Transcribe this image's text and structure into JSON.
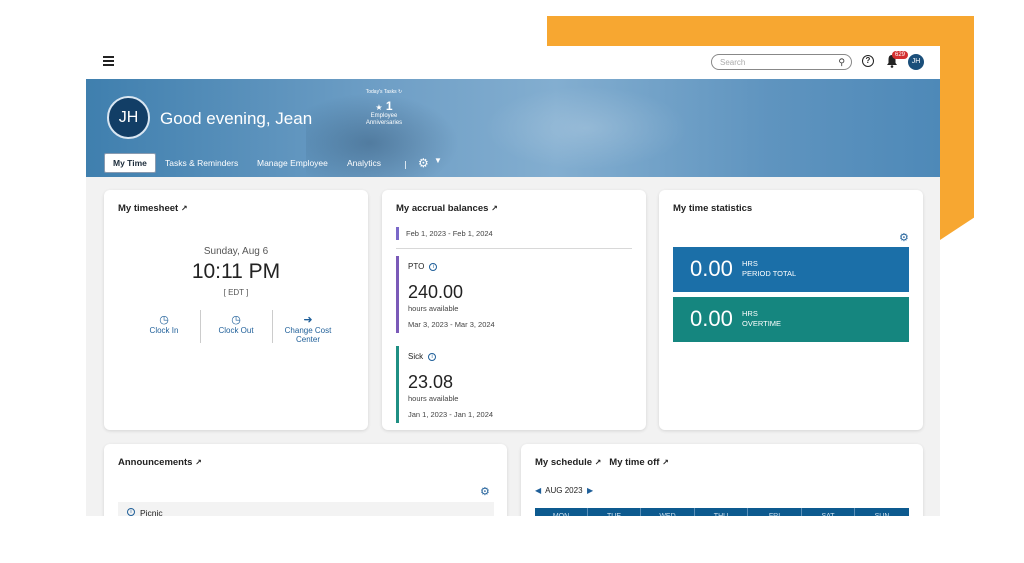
{
  "header": {
    "search_placeholder": "Search",
    "notification_count": "629",
    "user_initials": "JH"
  },
  "banner": {
    "avatar_initials": "JH",
    "greeting": "Good evening, Jean",
    "todays_tasks": {
      "title": "Today's Tasks",
      "count": "1",
      "label_line1": "Employee",
      "label_line2": "Anniversaries"
    },
    "tabs": [
      "My Time",
      "Tasks & Reminders",
      "Manage Employee",
      "Analytics"
    ]
  },
  "timesheet": {
    "title": "My timesheet",
    "date": "Sunday, Aug 6",
    "time": "10:11 PM",
    "timezone": "[ EDT ]",
    "actions": [
      {
        "label_line1": "Clock In",
        "label_line2": ""
      },
      {
        "label_line1": "Clock Out",
        "label_line2": ""
      },
      {
        "label_line1": "Change Cost",
        "label_line2": "Center"
      }
    ]
  },
  "accruals": {
    "title": "My accrual balances",
    "period": "Feb 1, 2023 - Feb 1, 2024",
    "items": [
      {
        "name": "PTO",
        "value": "240.00",
        "unit": "hours available",
        "range": "Mar 3, 2023 - Mar 3, 2024",
        "color": "#7a5ab8"
      },
      {
        "name": "Sick",
        "value": "23.08",
        "unit": "hours available",
        "range": "Jan 1, 2023 - Jan 1, 2024",
        "color": "#1f8f83"
      }
    ]
  },
  "statistics": {
    "title": "My time statistics",
    "items": [
      {
        "value": "0.00",
        "unit": "HRS",
        "label": "PERIOD TOTAL",
        "color": "#1b6fa8"
      },
      {
        "value": "0.00",
        "unit": "HRS",
        "label": "OVERTIME",
        "color": "#15867f"
      }
    ]
  },
  "announcements": {
    "title": "Announcements",
    "items": [
      {
        "label": "Picnic"
      }
    ]
  },
  "schedule": {
    "title": "My schedule",
    "title2": "My time off",
    "month": "AUG 2023",
    "days": [
      "MON",
      "TUE",
      "WED",
      "THU",
      "FRI",
      "SAT",
      "SUN"
    ]
  },
  "colors": {
    "brand_blue": "#1f5f99",
    "accent_orange": "#f7a731"
  }
}
